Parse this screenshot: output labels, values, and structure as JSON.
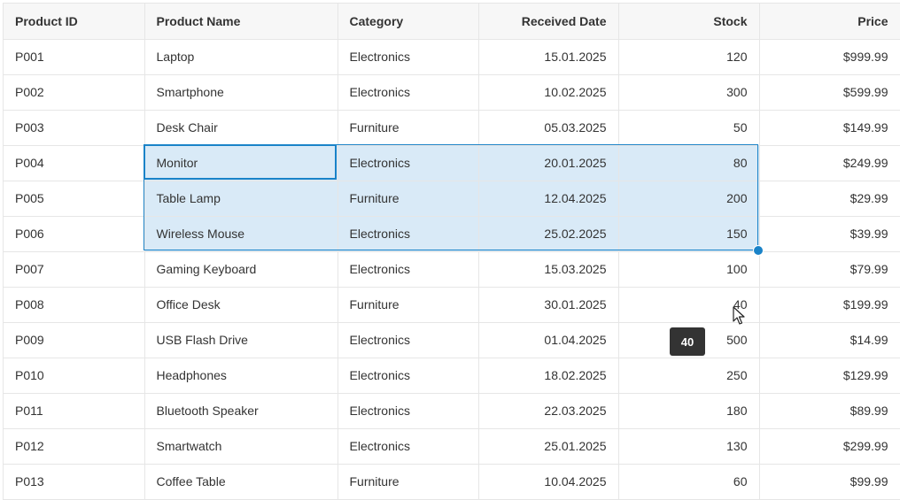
{
  "columns": [
    "Product ID",
    "Product Name",
    "Category",
    "Received Date",
    "Stock",
    "Price"
  ],
  "rows": [
    [
      "P001",
      "Laptop",
      "Electronics",
      "15.01.2025",
      "120",
      "$999.99"
    ],
    [
      "P002",
      "Smartphone",
      "Electronics",
      "10.02.2025",
      "300",
      "$599.99"
    ],
    [
      "P003",
      "Desk Chair",
      "Furniture",
      "05.03.2025",
      "50",
      "$149.99"
    ],
    [
      "P004",
      "Monitor",
      "Electronics",
      "20.01.2025",
      "80",
      "$249.99"
    ],
    [
      "P005",
      "Table Lamp",
      "Furniture",
      "12.04.2025",
      "200",
      "$29.99"
    ],
    [
      "P006",
      "Wireless Mouse",
      "Electronics",
      "25.02.2025",
      "150",
      "$39.99"
    ],
    [
      "P007",
      "Gaming Keyboard",
      "Electronics",
      "15.03.2025",
      "100",
      "$79.99"
    ],
    [
      "P008",
      "Office Desk",
      "Furniture",
      "30.01.2025",
      "40",
      "$199.99"
    ],
    [
      "P009",
      "USB Flash Drive",
      "Electronics",
      "01.04.2025",
      "500",
      "$14.99"
    ],
    [
      "P010",
      "Headphones",
      "Electronics",
      "18.02.2025",
      "250",
      "$129.99"
    ],
    [
      "P011",
      "Bluetooth Speaker",
      "Electronics",
      "22.03.2025",
      "180",
      "$89.99"
    ],
    [
      "P012",
      "Smartwatch",
      "Electronics",
      "25.01.2025",
      "130",
      "$299.99"
    ],
    [
      "P013",
      "Coffee Table",
      "Furniture",
      "10.04.2025",
      "60",
      "$99.99"
    ]
  ],
  "selection": {
    "rows": [
      "P004",
      "P005",
      "P006"
    ],
    "columns": [
      "Product Name",
      "Category",
      "Received Date",
      "Stock"
    ]
  },
  "drag_tooltip": "40",
  "colors": {
    "accent": "#1a83c8",
    "selection_fill": "#d9eaf7",
    "header_bg": "#f7f7f7",
    "grid_line": "#e6e6e6"
  },
  "icons": {
    "cursor": "mouse-pointer-icon",
    "fill_handle": "fill-handle-dot"
  }
}
